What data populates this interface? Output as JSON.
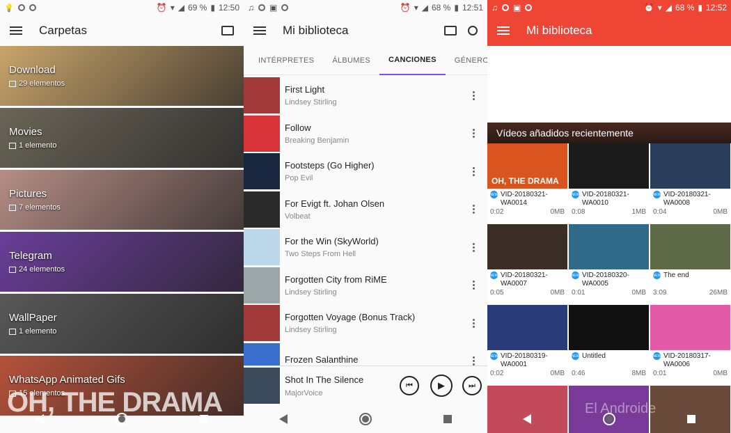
{
  "panel1": {
    "status": {
      "battery": "69 %",
      "time": "12:50"
    },
    "title": "Carpetas",
    "folders": [
      {
        "name": "Download",
        "count": "29 elementos",
        "bg": "#c9a46a"
      },
      {
        "name": "Movies",
        "count": "1 elemento",
        "bg": "#6b6558"
      },
      {
        "name": "Pictures",
        "count": "7 elementos",
        "bg": "#b58d86"
      },
      {
        "name": "Telegram",
        "count": "24 elementos",
        "bg": "#6a3e9a"
      },
      {
        "name": "WallPaper",
        "count": "1 elemento",
        "bg": "#585858"
      },
      {
        "name": "WhatsApp Animated Gifs",
        "count": "15 elementos",
        "bg": "#b5523a"
      }
    ],
    "overlay_text": "OH, THE DRAMA"
  },
  "panel2": {
    "status": {
      "battery": "68 %",
      "time": "12:51"
    },
    "title": "Mi biblioteca",
    "tabs": [
      "INTÉRPRETES",
      "ÁLBUMES",
      "CANCIONES",
      "GÉNEROS"
    ],
    "songs": [
      {
        "title": "First Light",
        "artist": "Lindsey Stirling",
        "color": "#a23a3a"
      },
      {
        "title": "Follow",
        "artist": "Breaking Benjamin",
        "color": "#d9333a"
      },
      {
        "title": "Footsteps (Go Higher)",
        "artist": "Pop Evil",
        "color": "#1a2740"
      },
      {
        "title": "For Evigt ft. Johan Olsen",
        "artist": "Volbeat",
        "color": "#2a2a2a"
      },
      {
        "title": "For the Win (SkyWorld)",
        "artist": "Two Steps From Hell",
        "color": "#bcd6ea"
      },
      {
        "title": "Forgotten City from RiME",
        "artist": "Lindsey Stirling",
        "color": "#9aa6a8"
      },
      {
        "title": "Forgotten Voyage (Bonus Track)",
        "artist": "Lindsey Stirling",
        "color": "#a23a3a"
      },
      {
        "title": "Frozen Salanthine",
        "artist": "",
        "color": "#3a6fcf"
      }
    ],
    "now_playing": {
      "title": "Shot In The Silence",
      "artist": "MajorVoice"
    }
  },
  "panel3": {
    "status": {
      "battery": "68 %",
      "time": "12:52"
    },
    "title": "Mi biblioteca",
    "section": "Vídeos añadidos recientemente",
    "videos": [
      {
        "name": "VID-20180321-WA0014",
        "duration": "0:02",
        "size": "0MB",
        "new": true,
        "bg": "#d9541e",
        "caption": "OH, THE DRAMA"
      },
      {
        "name": "VID-20180321-WA0010",
        "duration": "0:08",
        "size": "1MB",
        "new": true,
        "bg": "#1b1b1b",
        "caption": ""
      },
      {
        "name": "VID-20180321-WA0008",
        "duration": "0:04",
        "size": "0MB",
        "new": true,
        "bg": "#2a3d5a",
        "caption": ""
      },
      {
        "name": "VID-20180321-WA0007",
        "duration": "0:05",
        "size": "0MB",
        "new": true,
        "bg": "#3a2e26",
        "caption": ""
      },
      {
        "name": "VID-20180320-WA0005",
        "duration": "0:01",
        "size": "0MB",
        "new": true,
        "bg": "#2f6a8a",
        "caption": ""
      },
      {
        "name": "The end",
        "duration": "3:09",
        "size": "26MB",
        "new": true,
        "bg": "#5d6a48",
        "caption": ""
      },
      {
        "name": "VID-20180319-WA0001",
        "duration": "0:02",
        "size": "0MB",
        "new": true,
        "bg": "#2a3b7a",
        "caption": ""
      },
      {
        "name": "Untitled",
        "duration": "0:46",
        "size": "8MB",
        "new": true,
        "bg": "#111111",
        "caption": ""
      },
      {
        "name": "VID-20180317-WA0006",
        "duration": "0:01",
        "size": "0MB",
        "new": true,
        "bg": "#e35aa6",
        "caption": ""
      }
    ],
    "bottom_row": [
      {
        "bg": "#c24a5a"
      },
      {
        "bg": "#7a3a9a"
      },
      {
        "bg": "#6a4a3a"
      }
    ],
    "watermark": "El Androide"
  }
}
